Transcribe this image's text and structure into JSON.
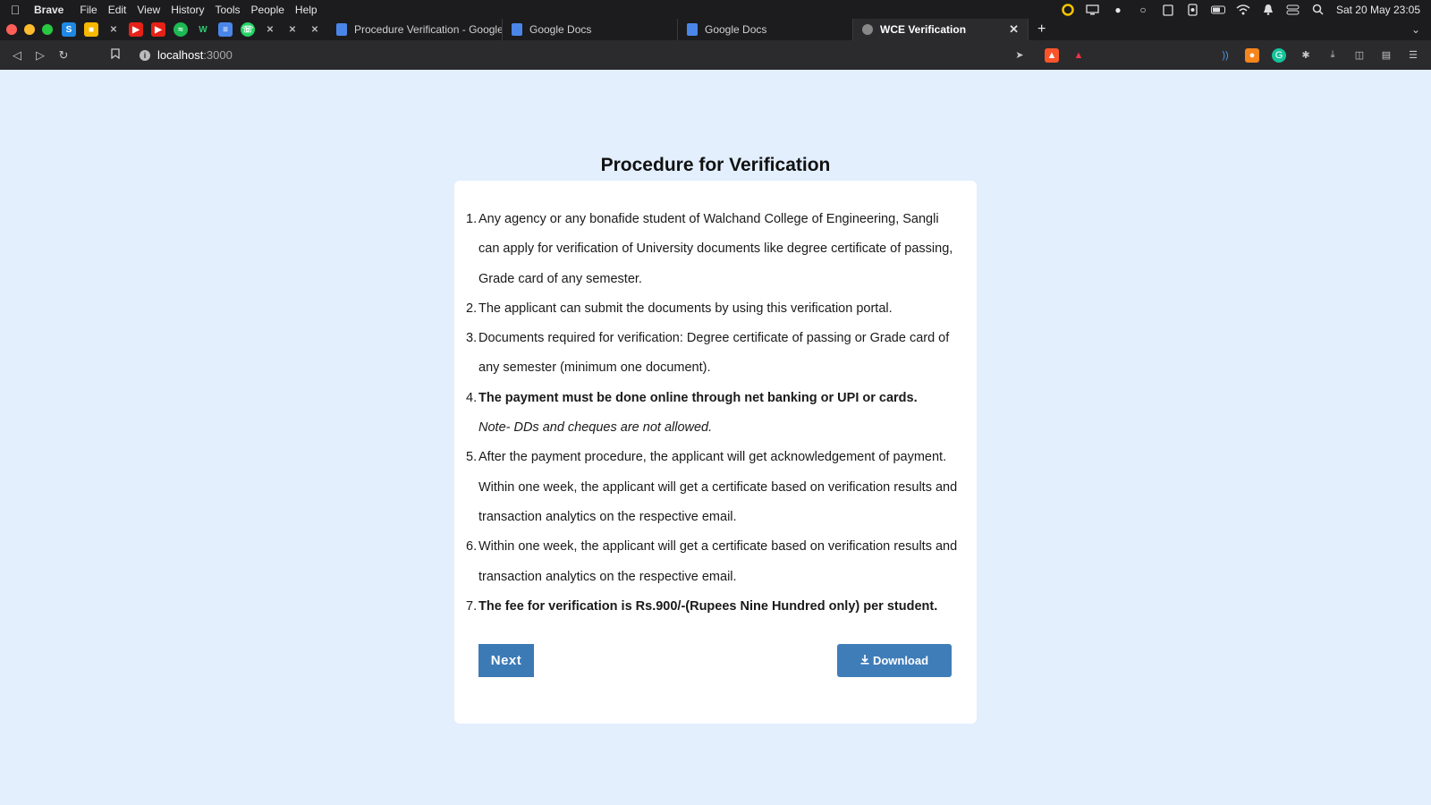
{
  "menubar": {
    "app_name": "Brave",
    "items": [
      "File",
      "Edit",
      "View",
      "History",
      "Tools",
      "People",
      "Help"
    ],
    "clock": "Sat 20 May 23:05"
  },
  "tabs": [
    {
      "label": "Procedure Verification - Google Docs",
      "active": false
    },
    {
      "label": "Google Docs",
      "active": false
    },
    {
      "label": "Google Docs",
      "active": false
    },
    {
      "label": "WCE Verification",
      "active": true
    }
  ],
  "toolbar": {
    "url_host": "localhost",
    "url_port": ":3000"
  },
  "page": {
    "title": "Procedure for Verification",
    "steps": [
      {
        "num": "1.",
        "text": "Any agency or any bonafide student of Walchand College of Engineering, Sangli can apply for verification of University documents like degree certificate of passing, Grade card of any semester."
      },
      {
        "num": "2.",
        "text": "The applicant can submit the documents by using this verification portal."
      },
      {
        "num": "3.",
        "text": "Documents required for verification: Degree certificate of passing or Grade card of any semester (minimum one document)."
      },
      {
        "num": "4.",
        "text": "The payment must be done online through net banking or UPI or cards.",
        "note": "Note- DDs and cheques are not allowed."
      },
      {
        "num": "5.",
        "text": "After the payment procedure, the applicant will get acknowledgement of payment. Within one week, the applicant will get a certificate based on verification results and transaction analytics on the respective email."
      },
      {
        "num": "6.",
        "text": "Within one week, the applicant will get a certificate based on verification results and transaction analytics on the respective email."
      },
      {
        "num": "7.",
        "text": "The fee for verification is Rs.900/-(Rupees Nine Hundred only) per student."
      }
    ],
    "next_label": "Next",
    "download_label": "Download"
  },
  "colors": {
    "page_bg": "#e3effd",
    "button_blue": "#3c7ab6"
  }
}
